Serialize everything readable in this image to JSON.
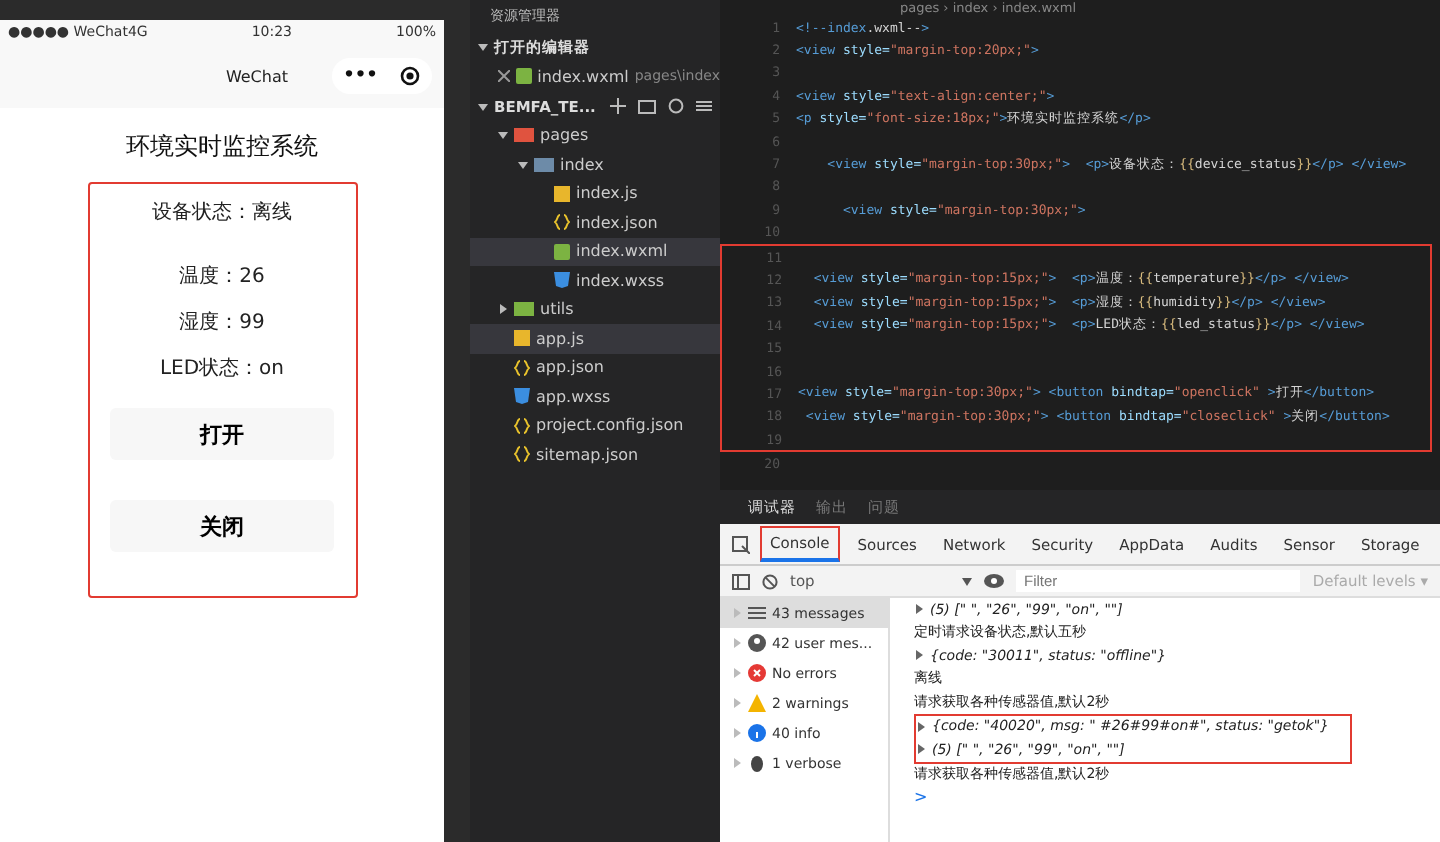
{
  "phone": {
    "status_bar": {
      "carrier": "●●●●● WeChat4G",
      "time": "10:23",
      "battery": "100%"
    },
    "nav": {
      "title": "WeChat",
      "menu": "•••"
    },
    "title": "环境实时监控系统",
    "status": "设备状态：离线",
    "readings": [
      "温度：26",
      "湿度：99",
      "LED状态：on"
    ],
    "buttons": [
      "打开",
      "关闭"
    ]
  },
  "explorer": {
    "title": "资源管理器",
    "open_editors": {
      "label": "打开的编辑器",
      "expanded": true,
      "files": [
        {
          "name": "index.wxml",
          "path": "pages\\index",
          "kind": "wxml"
        }
      ]
    },
    "project": {
      "label": "BEMFA_TE...",
      "expanded": true
    },
    "tree": [
      {
        "name": "pages",
        "kind": "folder",
        "expanded": true,
        "selected": false,
        "children": [
          {
            "name": "index",
            "kind": "folder-blue",
            "expanded": true,
            "selected": false,
            "children": [
              {
                "name": "index.js",
                "kind": "js",
                "selected": false
              },
              {
                "name": "index.json",
                "kind": "json",
                "selected": false
              },
              {
                "name": "index.wxml",
                "kind": "wxml",
                "selected": true
              },
              {
                "name": "index.wxss",
                "kind": "wxss",
                "selected": false
              }
            ]
          }
        ]
      },
      {
        "name": "utils",
        "kind": "folder-green",
        "expanded": false,
        "selected": false
      },
      {
        "name": "app.js",
        "kind": "js",
        "selected": true
      },
      {
        "name": "app.json",
        "kind": "json",
        "selected": false
      },
      {
        "name": "app.wxss",
        "kind": "wxss",
        "selected": false
      },
      {
        "name": "project.config.json",
        "kind": "json",
        "selected": false
      },
      {
        "name": "sitemap.json",
        "kind": "json",
        "selected": false
      }
    ]
  },
  "editor": {
    "breadcrumb": "pages › index › index.wxml",
    "blocks": [
      {
        "boxed": false,
        "lines": [
          {
            "number": "1",
            "text": "<!--index.wxml-->"
          },
          {
            "number": "2",
            "text": "<view style=\"margin-top:20px;\">"
          },
          {
            "number": "3"
          },
          {
            "number": "4",
            "text": "<view style=\"text-align:center;\">"
          },
          {
            "number": "5",
            "text": "<p style=\"font-size:18px;\">环境实时监控系统</p>"
          },
          {
            "number": "6"
          },
          {
            "number": "7",
            "text": "    <view style=\"margin-top:30px;\">  <p>设备状态：{{device_status}}</p> </view>"
          },
          {
            "number": "8"
          },
          {
            "number": "9",
            "text": "      <view style=\"margin-top:30px;\">"
          },
          {
            "number": "10"
          }
        ]
      },
      {
        "boxed": true,
        "lines": [
          {
            "number": "11"
          },
          {
            "number": "12",
            "text": "  <view style=\"margin-top:15px;\">  <p>温度：{{temperature}}</p> </view>"
          },
          {
            "number": "13",
            "text": "  <view style=\"margin-top:15px;\">  <p>湿度：{{humidity}}</p> </view>"
          },
          {
            "number": "14",
            "text": "  <view style=\"margin-top:15px;\">  <p>LED状态：{{led_status}}</p> </view>"
          },
          {
            "number": "15"
          },
          {
            "number": "16"
          },
          {
            "number": "17",
            "text": "<view style=\"margin-top:30px;\"> <button bindtap=\"openclick\" >打开</button>"
          },
          {
            "number": "18",
            "text": " <view style=\"margin-top:30px;\"> <button bindtap=\"closeclick\" >关闭</button>"
          },
          {
            "number": "19"
          }
        ]
      },
      {
        "boxed": false,
        "lines": [
          {
            "number": "20"
          }
        ]
      }
    ]
  },
  "devtools": {
    "tabs": [
      {
        "label": "调试器",
        "selected": true
      },
      {
        "label": "输出",
        "selected": false
      },
      {
        "label": "问题",
        "selected": false
      }
    ],
    "panel_tabs": [
      {
        "label": "Console",
        "selected": true
      },
      {
        "label": "Sources",
        "selected": false
      },
      {
        "label": "Network",
        "selected": false
      },
      {
        "label": "Security",
        "selected": false
      },
      {
        "label": "AppData",
        "selected": false
      },
      {
        "label": "Audits",
        "selected": false
      },
      {
        "label": "Sensor",
        "selected": false
      },
      {
        "label": "Storage",
        "selected": false
      }
    ],
    "context": "top",
    "filter": {
      "placeholder": "Filter"
    },
    "levels": "Default levels ▾",
    "sidebar": [
      {
        "label": "43 messages",
        "kind": "list",
        "selected": true
      },
      {
        "label": "42 user mes...",
        "kind": "user",
        "selected": false
      },
      {
        "label": "No errors",
        "kind": "error",
        "selected": false
      },
      {
        "label": "2 warnings",
        "kind": "warning",
        "selected": false
      },
      {
        "label": "40 info",
        "kind": "info",
        "selected": false
      },
      {
        "label": "1 verbose",
        "kind": "verbose",
        "selected": false
      }
    ],
    "console": [
      {
        "boxed": false,
        "entries": [
          {
            "kind": "object",
            "text": "(5) [\" \", \"26\", \"99\", \"on\", \"\"]"
          },
          {
            "kind": "text",
            "text": "定时请求设备状态,默认五秒"
          },
          {
            "kind": "object",
            "text": "{code: \"30011\", status: \"offline\"}"
          },
          {
            "kind": "text",
            "text": "离线"
          },
          {
            "kind": "text",
            "text": "请求获取各种传感器值,默认2秒"
          }
        ]
      },
      {
        "boxed": true,
        "entries": [
          {
            "kind": "object",
            "text": "{code: \"40020\", msg: \" #26#99#on#\", status: \"getok\"}"
          },
          {
            "kind": "object",
            "text": "(5) [\" \", \"26\", \"99\", \"on\", \"\"]"
          }
        ]
      },
      {
        "boxed": false,
        "entries": [
          {
            "kind": "text",
            "text": "请求获取各种传感器值,默认2秒"
          }
        ]
      }
    ],
    "prompt": ">"
  }
}
